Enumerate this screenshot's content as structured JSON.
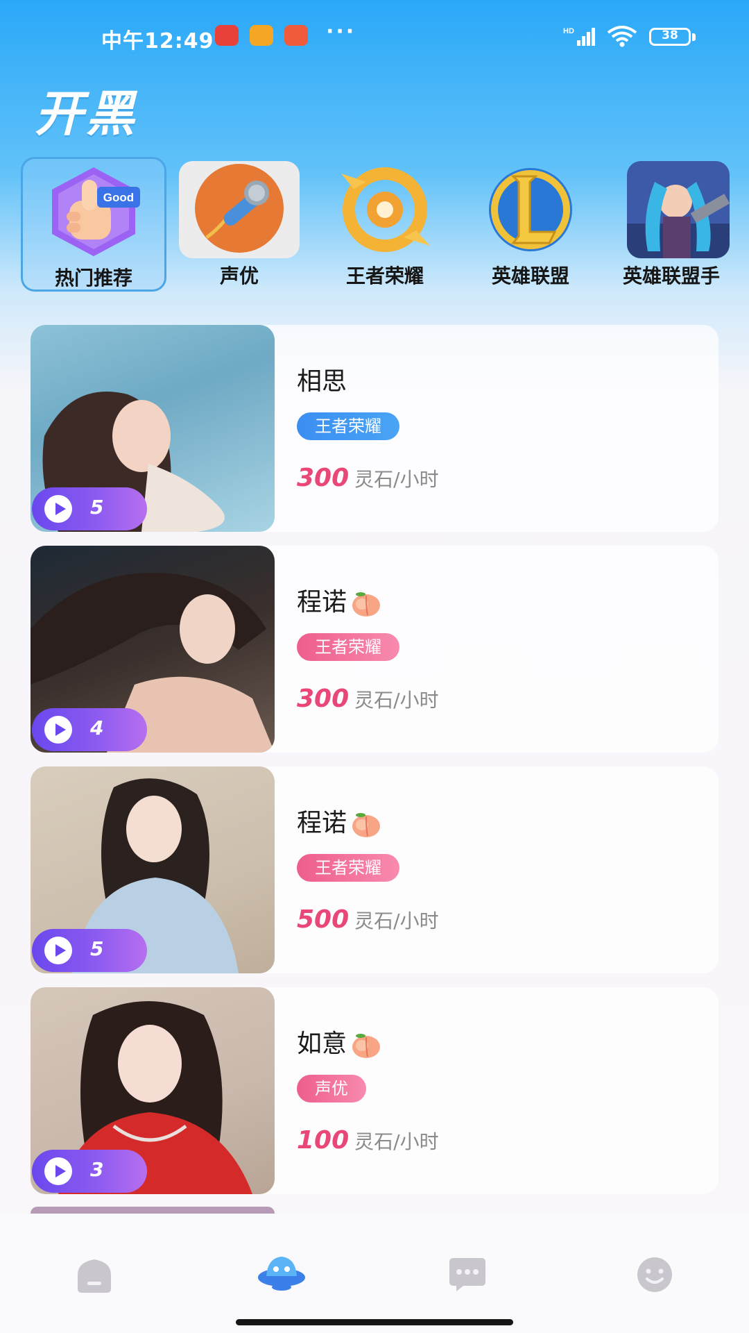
{
  "status_bar": {
    "time": "中午12:49",
    "dots": "···",
    "battery": "38",
    "network": "HD"
  },
  "header": {
    "title": "开黑"
  },
  "categories": [
    {
      "label": "热门推荐",
      "icon": "thumbs-up-good-icon",
      "selected": true
    },
    {
      "label": "声优",
      "icon": "microphone-icon",
      "selected": false
    },
    {
      "label": "王者荣耀",
      "icon": "honor-of-kings-icon",
      "selected": false
    },
    {
      "label": "英雄联盟",
      "icon": "league-of-legends-icon",
      "selected": false
    },
    {
      "label": "英雄联盟手",
      "icon": "lol-mobile-icon",
      "selected": false
    }
  ],
  "cards": [
    {
      "name": "相思",
      "peach": false,
      "tag": "王者荣耀",
      "tag_color": "#3a8ef1",
      "price": "300",
      "unit": "灵石/小时",
      "plays": "5"
    },
    {
      "name": "程诺",
      "peach": true,
      "tag": "王者荣耀",
      "tag_color": "#ee5e8c",
      "price": "300",
      "unit": "灵石/小时",
      "plays": "4"
    },
    {
      "name": "程诺",
      "peach": true,
      "tag": "王者荣耀",
      "tag_color": "#ee5e8c",
      "price": "500",
      "unit": "灵石/小时",
      "plays": "5"
    },
    {
      "name": "如意",
      "peach": true,
      "tag": "声优",
      "tag_color": "#ee5e8c",
      "price": "100",
      "unit": "灵石/小时",
      "plays": "3"
    }
  ],
  "bottom_nav": [
    {
      "icon": "home-icon",
      "active": false
    },
    {
      "icon": "planet-icon",
      "active": true
    },
    {
      "icon": "chat-bubble-icon",
      "active": false
    },
    {
      "icon": "smiley-profile-icon",
      "active": false
    }
  ],
  "colors": {
    "accent_blue": "#2aa8f8",
    "price_pink": "#e94778",
    "badge_purple": "#6a48ee"
  }
}
